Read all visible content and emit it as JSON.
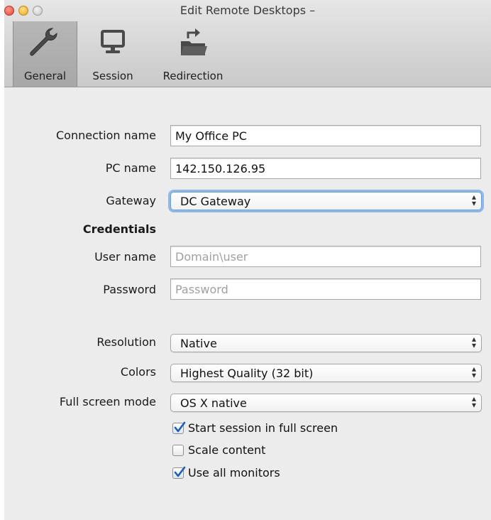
{
  "window": {
    "title": "Edit Remote Desktops –"
  },
  "tabs": [
    {
      "label": "General",
      "icon": "wrench-icon",
      "selected": true
    },
    {
      "label": "Session",
      "icon": "monitor-icon",
      "selected": false
    },
    {
      "label": "Redirection",
      "icon": "folder-redirect-icon",
      "selected": false
    }
  ],
  "form": {
    "connection_name": {
      "label": "Connection name",
      "value": "My Office PC"
    },
    "pc_name": {
      "label": "PC name",
      "value": "142.150.126.95"
    },
    "gateway": {
      "label": "Gateway",
      "selected": "DC Gateway"
    },
    "credentials_heading": "Credentials",
    "user_name": {
      "label": "User name",
      "value": "",
      "placeholder": "Domain\\user"
    },
    "password": {
      "label": "Password",
      "value": "",
      "placeholder": "Password"
    },
    "resolution": {
      "label": "Resolution",
      "selected": "Native"
    },
    "colors": {
      "label": "Colors",
      "selected": "Highest Quality (32 bit)"
    },
    "full_screen_mode": {
      "label": "Full screen mode",
      "selected": "OS X native"
    },
    "checkboxes": [
      {
        "label": "Start session in full screen",
        "checked": true
      },
      {
        "label": "Scale content",
        "checked": false
      },
      {
        "label": "Use all monitors",
        "checked": true
      }
    ]
  },
  "colors": {
    "focus_ring": "#8fb8ea",
    "check_mark": "#1c5fb4",
    "toolbar_selected": "#ababab"
  }
}
